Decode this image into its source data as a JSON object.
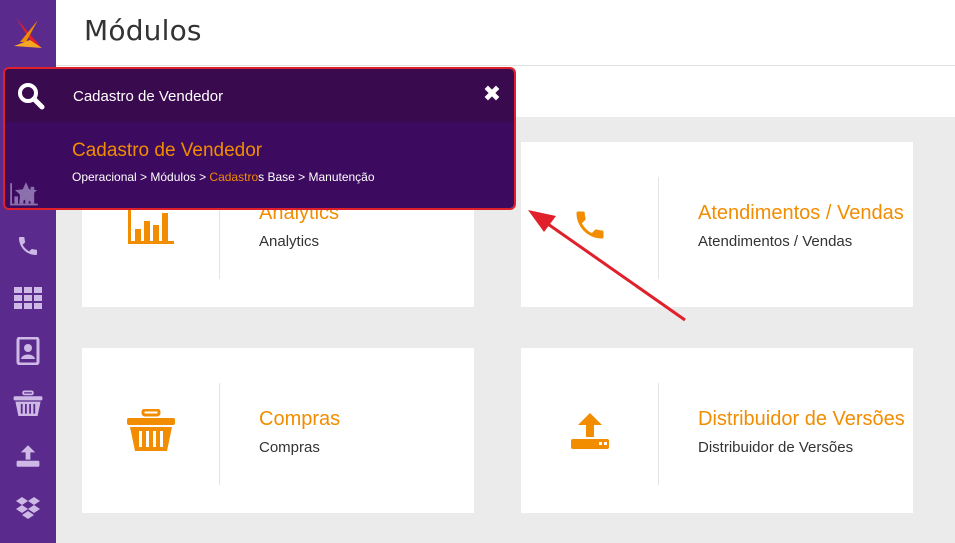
{
  "header": {
    "title": "Módulos"
  },
  "search": {
    "value": "Cadastro de Vendedor",
    "close_icon": "close-icon"
  },
  "result": {
    "title": "Cadastro de Vendedor",
    "path_before": "Operacional > Módulos > ",
    "path_highlight": "Cadastro",
    "path_after": "s Base > Manutenção"
  },
  "sidebar": {
    "items": [
      {
        "icon": "search-icon"
      },
      {
        "icon": "star-icon"
      },
      {
        "icon": "bar-chart-icon"
      },
      {
        "icon": "phone-icon"
      },
      {
        "icon": "grid-icon"
      },
      {
        "icon": "contact-book-icon"
      },
      {
        "icon": "basket-icon"
      },
      {
        "icon": "upload-icon"
      },
      {
        "icon": "dropbox-icon"
      }
    ]
  },
  "modules": [
    {
      "title": "Analytics",
      "subtitle": "Analytics",
      "icon": "bar-chart-icon"
    },
    {
      "title": "Atendimentos / Vendas",
      "subtitle": "Atendimentos / Vendas",
      "icon": "phone-icon"
    },
    {
      "title": "Compras",
      "subtitle": "Compras",
      "icon": "basket-icon"
    },
    {
      "title": "Distribuidor de Versões",
      "subtitle": "Distribuidor de Versões",
      "icon": "upload-icon"
    }
  ],
  "colors": {
    "sidebar": "#5a2a8c",
    "accent": "#f28c00",
    "search_bar": "#3a0a4f",
    "result_bg": "#3c0a5e",
    "highlight_border": "#e0202a"
  }
}
